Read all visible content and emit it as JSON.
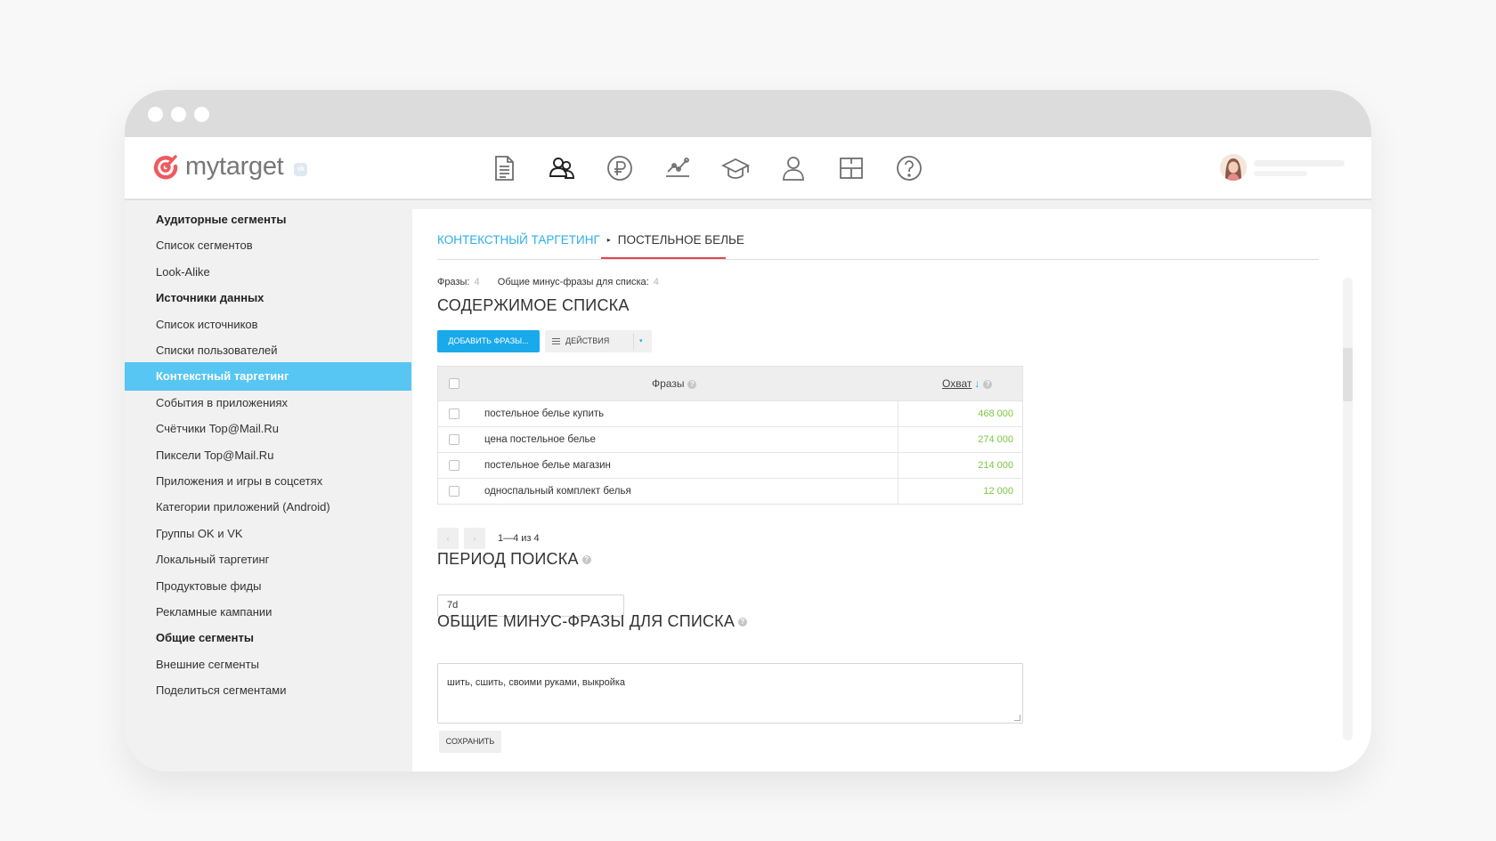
{
  "app": {
    "logo_text": "mytarget",
    "logo_badge": "vk"
  },
  "nav": {
    "icons": [
      "report-icon",
      "audience-icon",
      "ruble-icon",
      "statistics-icon",
      "education-icon",
      "profile-icon",
      "layout-icon",
      "help-icon"
    ]
  },
  "sidebar": {
    "items": [
      {
        "label": "Аудиторные сегменты",
        "type": "heading"
      },
      {
        "label": "Список сегментов",
        "type": "link"
      },
      {
        "label": "Look-Alike",
        "type": "link"
      },
      {
        "label": "Источники данных",
        "type": "heading"
      },
      {
        "label": "Список источников",
        "type": "link"
      },
      {
        "label": "Списки пользователей",
        "type": "link"
      },
      {
        "label": "Контекстный таргетинг",
        "type": "active"
      },
      {
        "label": "События в приложениях",
        "type": "link"
      },
      {
        "label": "Счётчики Top@Mail.Ru",
        "type": "link"
      },
      {
        "label": "Пиксели Top@Mail.Ru",
        "type": "link"
      },
      {
        "label": "Приложения и игры в соцсетях",
        "type": "link"
      },
      {
        "label": "Категории приложений (Android)",
        "type": "link"
      },
      {
        "label": "Группы OK и VK",
        "type": "link"
      },
      {
        "label": "Локальный таргетинг",
        "type": "link"
      },
      {
        "label": "Продуктовые фиды",
        "type": "link"
      },
      {
        "label": "Рекламные кампании",
        "type": "link"
      },
      {
        "label": "Общие сегменты",
        "type": "heading"
      },
      {
        "label": "Внешние сегменты",
        "type": "link"
      },
      {
        "label": "Поделиться сегментами",
        "type": "link"
      }
    ]
  },
  "breadcrumb": {
    "parent": "КОНТЕКСТНЫЙ ТАРГЕТИНГ",
    "separator": "▸",
    "current": "ПОСТЕЛЬНОЕ БЕЛЬЕ"
  },
  "meta": {
    "phrases_label": "Фразы:",
    "phrases_count": "4",
    "minus_label": "Общие минус-фразы для списка:",
    "minus_count": "4"
  },
  "list_section": {
    "title": "СОДЕРЖИМОЕ СПИСКА",
    "add_button": "ДОБАВИТЬ ФРАЗЫ...",
    "actions_button": "ДЕЙСТВИЯ",
    "actions_caret": "▾"
  },
  "table": {
    "headers": {
      "phrases": "Фразы",
      "coverage": "Охват",
      "sort_arrow": "↓"
    },
    "rows": [
      {
        "phrase": "постельное белье купить",
        "coverage": "468 000"
      },
      {
        "phrase": "цена постельное белье",
        "coverage": "274 000"
      },
      {
        "phrase": "постельное белье магазин",
        "coverage": "214 000"
      },
      {
        "phrase": "односпальный комплект белья",
        "coverage": "12 000"
      }
    ]
  },
  "pager": {
    "prev": "‹",
    "next": "›",
    "range_text": "1—4 из 4"
  },
  "period": {
    "title": "ПЕРИОД ПОИСКА",
    "value": "7d"
  },
  "minus": {
    "title": "ОБЩИЕ МИНУС-ФРАЗЫ ДЛЯ СПИСКА",
    "value": "шить, сшить, своими руками, выкройка"
  },
  "save_button": "СОХРАНИТЬ",
  "colors": {
    "accent": "#1aa9eb",
    "active_sidebar": "#57c6f2",
    "coverage_green": "#7ac943",
    "underline_red": "#e4434d",
    "logo_red": "#ef5a5f"
  }
}
